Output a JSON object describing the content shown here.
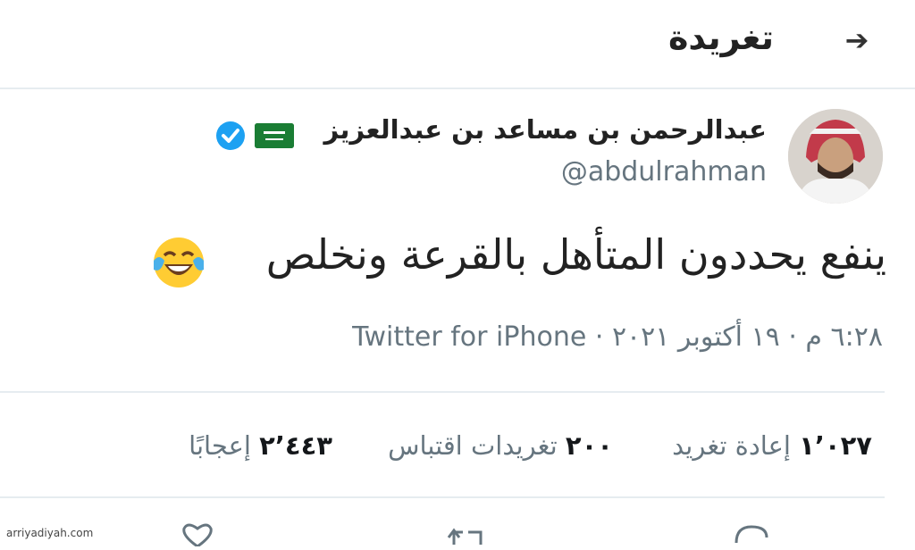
{
  "header": {
    "title": "تغريدة",
    "back_icon": "arrow-right-icon"
  },
  "user": {
    "name": "عبدالرحمن بن مساعد بن عبدالعزيز",
    "handle": "@abdulrahman",
    "verified": true,
    "flag_icon": "saudi-flag-icon",
    "flag_color": "#1a7d34",
    "verified_color": "#1da1f2"
  },
  "tweet": {
    "text": "ينفع يحددون المتأهل بالقرعة ونخلص",
    "emoji_icon": "face-with-tears-of-joy-icon",
    "time": "٦:٢٨ م",
    "date": "١٩ أكتوبر ٢٠٢١",
    "separator": "·",
    "client": "Twitter for iPhone"
  },
  "stats": {
    "retweets": {
      "count": "١٬٠٢٧",
      "label": "إعادة تغريد"
    },
    "quotes": {
      "count": "٢٠٠",
      "label": "تغريدات اقتباس"
    },
    "likes": {
      "count": "٢٬٤٤٣",
      "label": "إعجابًا"
    }
  },
  "actions": [
    "reply-icon",
    "retweet-icon",
    "like-icon"
  ],
  "credit": "arriyadiyah.com"
}
